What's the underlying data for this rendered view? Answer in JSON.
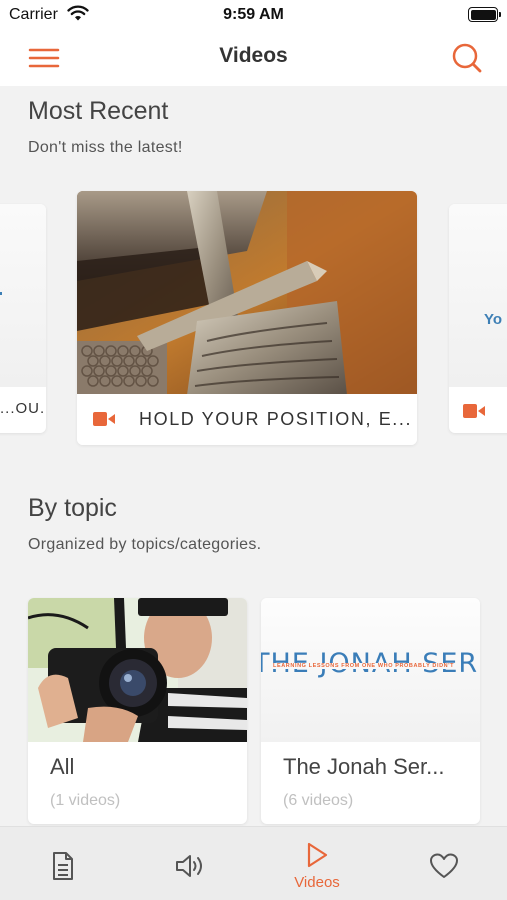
{
  "status_bar": {
    "carrier": "Carrier",
    "time": "9:59 AM"
  },
  "nav": {
    "title": "Videos",
    "menu_icon": "hamburger-menu-icon",
    "search_icon": "search-icon"
  },
  "most_recent": {
    "title": "Most Recent",
    "subtitle": "Don't miss the latest!",
    "cards": [
      {
        "label": "...OU...",
        "position": "previous-partial"
      },
      {
        "label": "HOLD YOUR POSITION, E...",
        "position": "current"
      },
      {
        "label": "Yo",
        "position": "next-partial"
      }
    ]
  },
  "by_topic": {
    "title": "By topic",
    "subtitle": "Organized by topics/categories.",
    "topics": [
      {
        "name": "All",
        "count": "(1 videos)"
      },
      {
        "name": "The Jonah Ser...",
        "count": "(6 videos)",
        "image_text": "THE JONAH SERIES",
        "image_tagline": "LEARNING LESSONS FROM ONE WHO PROBABLY DIDN'T"
      }
    ]
  },
  "tab_bar": {
    "tabs": [
      {
        "icon": "document-icon",
        "label": ""
      },
      {
        "icon": "speaker-icon",
        "label": ""
      },
      {
        "icon": "play-icon",
        "label": "Videos",
        "active": true
      },
      {
        "icon": "heart-icon",
        "label": ""
      }
    ]
  },
  "colors": {
    "accent": "#e8673a",
    "background": "#f2f2f2",
    "card": "#ffffff",
    "text": "#333333"
  }
}
